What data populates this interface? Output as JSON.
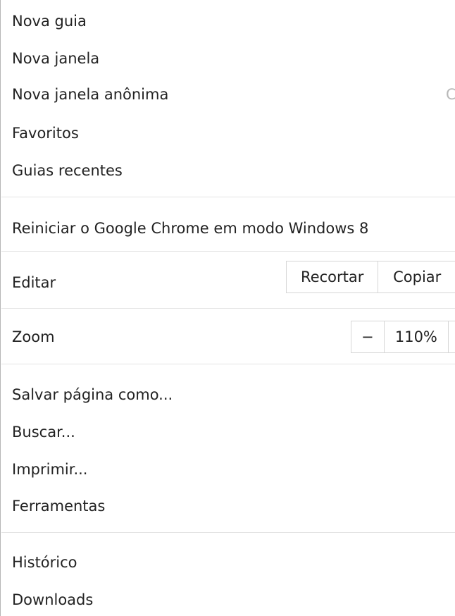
{
  "menu": {
    "group1": [
      {
        "label": "Nova guia"
      },
      {
        "label": "Nova janela"
      },
      {
        "label": "Nova janela anônima"
      },
      {
        "label": "Favoritos"
      },
      {
        "label": "Guias recentes"
      }
    ],
    "anon_shortcut_partial": "C",
    "restart_label": "Reiniciar o Google Chrome em modo Windows 8",
    "edit": {
      "label": "Editar",
      "cut": "Recortar",
      "copy": "Copiar"
    },
    "zoom": {
      "label": "Zoom",
      "minus": "−",
      "level": "110%"
    },
    "group2": [
      {
        "label": "Salvar página como..."
      },
      {
        "label": "Buscar..."
      },
      {
        "label": "Imprimir..."
      },
      {
        "label": "Ferramentas"
      }
    ],
    "group3": [
      {
        "label": "Histórico"
      },
      {
        "label": "Downloads"
      }
    ]
  }
}
